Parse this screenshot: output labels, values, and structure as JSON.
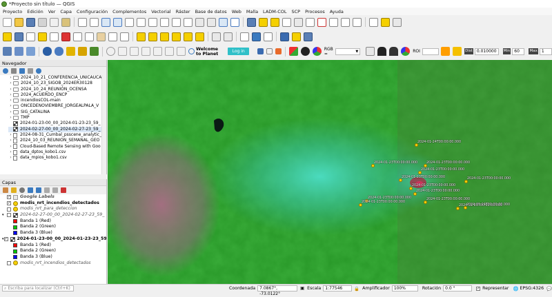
{
  "window": {
    "title": "*Proyecto sin título — QGIS"
  },
  "menu": [
    "Proyecto",
    "Edición",
    "Ver",
    "Capa",
    "Configuración",
    "Complementos",
    "Vectorial",
    "Ráster",
    "Base de datos",
    "Web",
    "Malla",
    "LADM-COL",
    "SCP",
    "Procesos",
    "Ayuda"
  ],
  "planet": {
    "welcome": "Welcome to Planet",
    "login": "Log in"
  },
  "scp_toolbar": {
    "rgb_label": "RGB =",
    "roi_label": "ROI",
    "dist_label": "Dist",
    "dist_value": "0.010000",
    "min_label": "Min",
    "min_value": "60",
    "max_label": "Max",
    "max_value": "1"
  },
  "browser": {
    "title": "Navegador",
    "items": [
      {
        "label": "2024_10_21_CONFERENCIA_UNICAUCA",
        "type": "folder"
      },
      {
        "label": "2024_10_23_SIGOB_2024ER30128",
        "type": "folder"
      },
      {
        "label": "2024_10_24_REUNIÓN_OCENSA",
        "type": "folder"
      },
      {
        "label": "2024_ACUERDO_ENCP",
        "type": "folder"
      },
      {
        "label": "incendiosCOL-main",
        "type": "folder"
      },
      {
        "label": "ONCEDENOVIEMBRE_JORGEALPALA_V",
        "type": "folder"
      },
      {
        "label": "SIG_CATALINA",
        "type": "folder"
      },
      {
        "label": "TMP",
        "type": "folder"
      },
      {
        "label": "2024-01-23-00_00_2024-01-23-23_59_",
        "type": "raster"
      },
      {
        "label": "2024-02-27-00_00_2024-02-27-23_59_",
        "type": "raster"
      },
      {
        "label": "2024-08-31_Cumbal_psscene_analytic_",
        "type": "file"
      },
      {
        "label": "2024_10_03_REUNION_SEMANAL_GEO",
        "type": "file"
      },
      {
        "label": "Cloud-Based Remote Sensing with Goo",
        "type": "file"
      },
      {
        "label": "data_dptos_kobo1.csv",
        "type": "file"
      },
      {
        "label": "data_mpios_kobo1.csv",
        "type": "file"
      }
    ]
  },
  "layers": {
    "title": "Capas",
    "items": [
      {
        "label": "Google Labels",
        "kind": "group",
        "checked": true
      },
      {
        "label": "modis_nrt_incendios_detectados",
        "kind": "point",
        "checked": true
      },
      {
        "label": "modis_nrt_para_deteccion",
        "kind": "point-off",
        "checked": false
      },
      {
        "label": "2024-02-27-00_00_2024-02-27-23_59_",
        "kind": "raster-off",
        "checked": false
      },
      {
        "label": "Banda 1 (Red)",
        "kind": "band",
        "color": "#ff0000"
      },
      {
        "label": "Banda 2 (Green)",
        "kind": "band",
        "color": "#00c800"
      },
      {
        "label": "Banda 3 (Blue)",
        "kind": "band",
        "color": "#0000ff"
      },
      {
        "label": "2024-01-23-00_00_2024-01-23-23_59_",
        "kind": "raster",
        "checked": true
      },
      {
        "label": "Banda 1 (Red)",
        "kind": "band",
        "color": "#ff0000"
      },
      {
        "label": "Banda 2 (Green)",
        "kind": "band",
        "color": "#00c800"
      },
      {
        "label": "Banda 3 (Blue)",
        "kind": "band",
        "color": "#0000ff"
      },
      {
        "label": "modis_nrt_incendios_detectados",
        "kind": "point-off",
        "checked": false
      }
    ]
  },
  "map_labels": [
    {
      "text": "2024-01-24T00:00:00.000"
    },
    {
      "text": "2024-01-23T00:00:00.000"
    },
    {
      "text": "2024-01-23T00:00:00.000"
    },
    {
      "text": "2024-01-23T00:00:00.000"
    },
    {
      "text": "2024-01-23T00:00:00.000"
    },
    {
      "text": "2024-01-23T00:00:00.000"
    },
    {
      "text": "2024-01-23T00:00:00.000"
    },
    {
      "text": "2024-01-23T00:00:00.000"
    },
    {
      "text": "2024-01-23T00:00:00.000"
    },
    {
      "text": "2024-01-23T00:00:00.000"
    },
    {
      "text": "2024-01-23T00:00:00.000"
    },
    {
      "text": "2024-01-23T00:00:00.000"
    },
    {
      "text": "2024-01-24T00:00:00.000"
    }
  ],
  "status": {
    "search_placeholder": "Escriba para localizar (Ctrl+K)",
    "coord_label": "Coordenada",
    "coord_value": "7.0867°, -73.0122°",
    "scale_label": "Escala",
    "scale_value": "1:77546",
    "magnifier_label": "Amplificador",
    "magnifier_value": "100%",
    "rotation_label": "Rotación",
    "rotation_value": "0.0 °",
    "render_label": "Representar",
    "crs_label": "EPSG:4326"
  }
}
